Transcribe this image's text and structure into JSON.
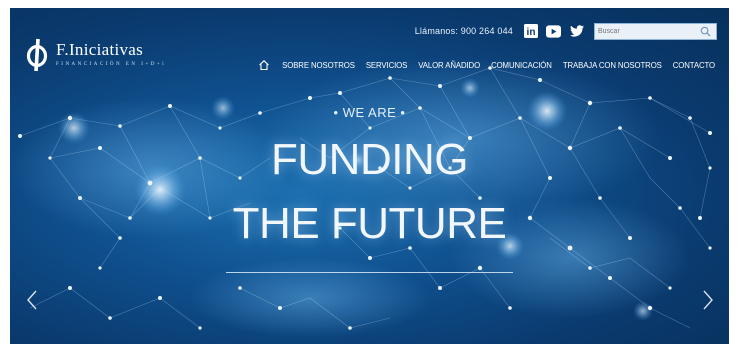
{
  "header": {
    "call_text": "Llámanos: 900 264 044",
    "social": [
      {
        "icon": "linkedin-icon",
        "glyph": "in"
      },
      {
        "icon": "youtube-icon"
      },
      {
        "icon": "twitter-icon"
      }
    ],
    "search_placeholder": "Buscar"
  },
  "logo": {
    "brand": "F.Iniciativas",
    "tagline": "FINANCIACIÓN EN I+D+i"
  },
  "nav": {
    "items": [
      "SOBRE NOSOTROS",
      "SERVICIOS",
      "VALOR AÑADIDO",
      "COMUNICACIÓN",
      "TRABAJA CON NOSOTROS",
      "CONTACTO"
    ]
  },
  "hero": {
    "kicker": "• WE ARE •",
    "line1": "FUNDING",
    "line2": "THE FUTURE"
  },
  "colors": {
    "background_deep": "#07305c",
    "background_mid": "#1c6fb0",
    "text": "#ffffff",
    "glow": "#bfe3ff"
  }
}
